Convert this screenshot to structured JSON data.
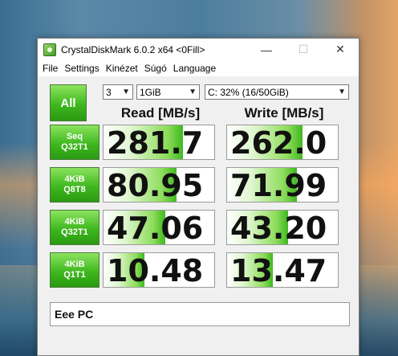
{
  "window": {
    "title": "CrystalDiskMark 6.0.2 x64 <0Fill>",
    "controls": {
      "minimize": "—",
      "maximize": "☐",
      "close": "✕"
    }
  },
  "menu": [
    "File",
    "Settings",
    "Kinézet",
    "Súgó",
    "Language"
  ],
  "toolbar": {
    "all_label": "All",
    "count": "3",
    "size": "1GiB",
    "drive": "C: 32% (16/50GiB)"
  },
  "headers": {
    "read": "Read [MB/s]",
    "write": "Write [MB/s]"
  },
  "rows": [
    {
      "line1": "Seq",
      "line2": "Q32T1",
      "read": "281.7",
      "write": "262.0",
      "read_fill": 0.72,
      "write_fill": 0.68
    },
    {
      "line1": "4KiB",
      "line2": "Q8T8",
      "read": "80.95",
      "write": "71.99",
      "read_fill": 0.66,
      "write_fill": 0.63
    },
    {
      "line1": "4KiB",
      "line2": "Q32T1",
      "read": "47.06",
      "write": "43.20",
      "read_fill": 0.56,
      "write_fill": 0.55
    },
    {
      "line1": "4KiB",
      "line2": "Q1T1",
      "read": "10.48",
      "write": "13.47",
      "read_fill": 0.37,
      "write_fill": 0.41
    }
  ],
  "comment": "Eee PC",
  "colors": {
    "accent_green": "#3fb81f",
    "window_bg": "#f0f0f0"
  }
}
